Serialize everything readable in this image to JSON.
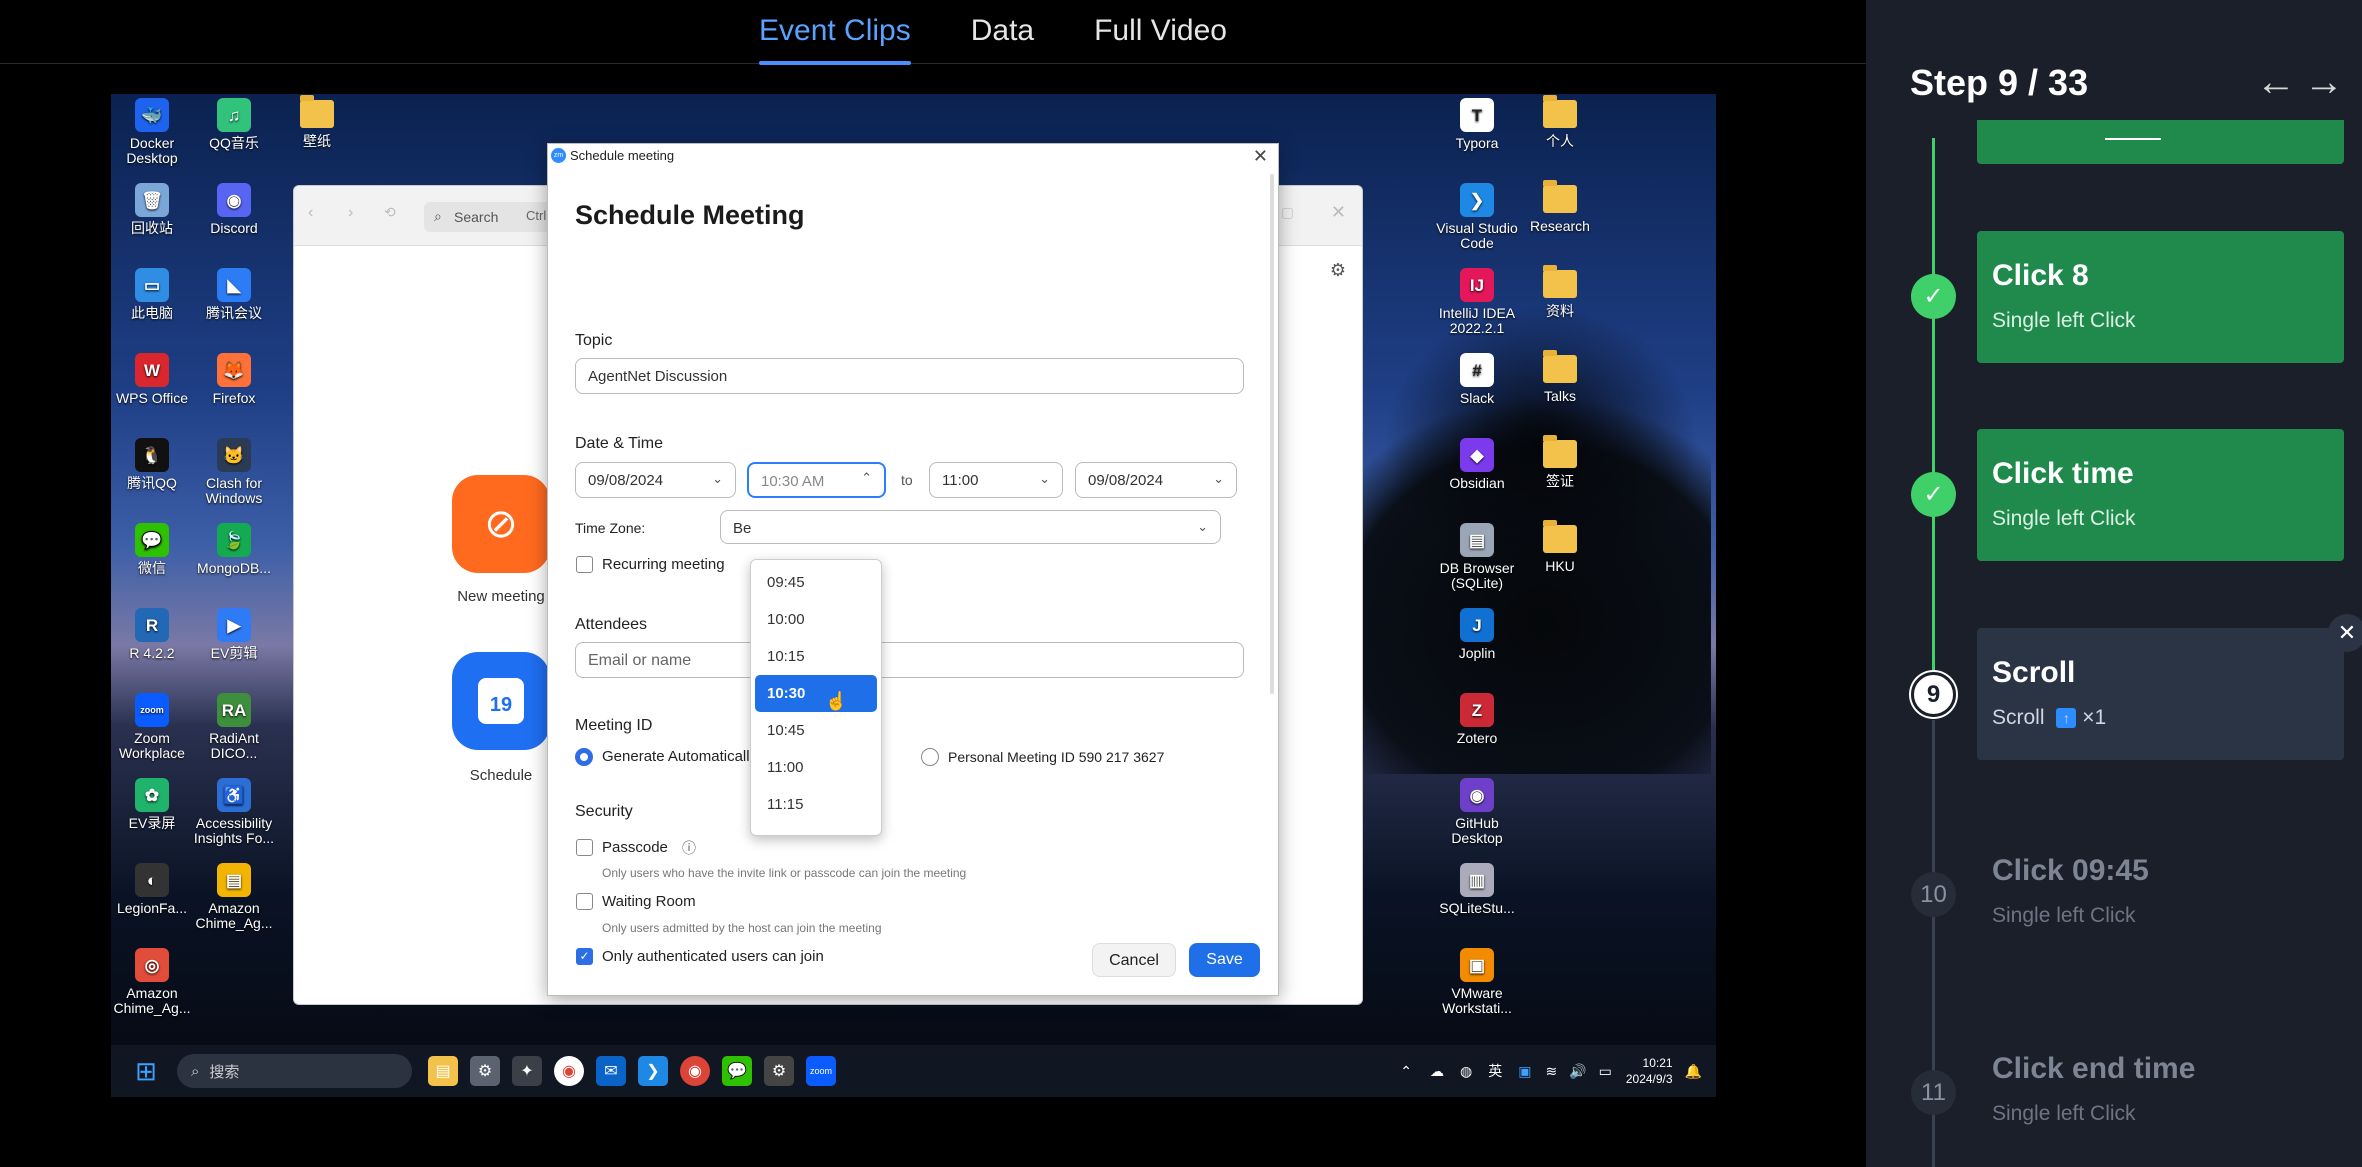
{
  "tabs": [
    "Event Clips",
    "Data",
    "Full Video"
  ],
  "desktop": {
    "left_icons": [
      {
        "label": "Docker Desktop",
        "color": "#1d63ed",
        "glyph": "🐳"
      },
      {
        "label": "QQ音乐",
        "color": "#31c27c",
        "glyph": "♫"
      },
      {
        "label": "壁纸",
        "color": "",
        "glyph": "folder"
      },
      {
        "label": "回收站",
        "color": "#7aa6d8",
        "glyph": "🗑"
      },
      {
        "label": "Discord",
        "color": "#5865f2",
        "glyph": "◉"
      },
      {
        "label": "此电脑",
        "color": "#2f8de4",
        "glyph": "▭"
      },
      {
        "label": "腾讯会议",
        "color": "#2c7cf6",
        "glyph": "◣"
      },
      {
        "label": "WPS Office",
        "color": "#d9272d",
        "glyph": "W"
      },
      {
        "label": "Firefox",
        "color": "#ff7139",
        "glyph": "🦊"
      },
      {
        "label": "腾讯QQ",
        "color": "#111",
        "glyph": "🐧"
      },
      {
        "label": "Clash for Windows",
        "color": "#2b3a55",
        "glyph": "🐱"
      },
      {
        "label": "微信",
        "color": "#2dc100",
        "glyph": "💬"
      },
      {
        "label": "MongoDB...",
        "color": "#13aa52",
        "glyph": "🍃"
      },
      {
        "label": "R 4.2.2",
        "color": "#2268b5",
        "glyph": "R"
      },
      {
        "label": "EV剪辑",
        "color": "#2f7af5",
        "glyph": "▶"
      },
      {
        "label": "Zoom Workplace",
        "color": "#0b5cff",
        "glyph": "zoom"
      },
      {
        "label": "RadiAnt DICO...",
        "color": "#3d8f3d",
        "glyph": "RA"
      },
      {
        "label": "EV录屏",
        "color": "#1fb36b",
        "glyph": "✿"
      },
      {
        "label": "Accessibility Insights Fo...",
        "color": "#2b6fd6",
        "glyph": "♿"
      },
      {
        "label": "LegionFa...",
        "color": "#333",
        "glyph": "◐"
      },
      {
        "label": "Amazon Chime_Ag...",
        "color": "#f2b400",
        "glyph": "▤"
      },
      {
        "label": "Amazon Chime_Ag...",
        "color": "#e24c3a",
        "glyph": "◎"
      }
    ],
    "right_icons": [
      {
        "label": "Typora",
        "color": "#fff",
        "glyph": "T"
      },
      {
        "label": "个人",
        "color": "",
        "glyph": "folder"
      },
      {
        "label": "Visual Studio Code",
        "color": "#1e88e5",
        "glyph": "❯"
      },
      {
        "label": "Research",
        "color": "",
        "glyph": "folder"
      },
      {
        "label": "IntelliJ IDEA 2022.2.1",
        "color": "#e3175a",
        "glyph": "IJ"
      },
      {
        "label": "资料",
        "color": "",
        "glyph": "folder"
      },
      {
        "label": "Slack",
        "color": "#fff",
        "glyph": "#"
      },
      {
        "label": "Talks",
        "color": "",
        "glyph": "folder"
      },
      {
        "label": "Obsidian",
        "color": "#7c3aed",
        "glyph": "◆"
      },
      {
        "label": "签证",
        "color": "",
        "glyph": "folder"
      },
      {
        "label": "DB Browser (SQLite)",
        "color": "#9aa5b5",
        "glyph": "▤"
      },
      {
        "label": "HKU",
        "color": "",
        "glyph": "folder"
      },
      {
        "label": "Joplin",
        "color": "#1071d3",
        "glyph": "J"
      },
      {
        "label": "Zotero",
        "color": "#cc2936",
        "glyph": "Z"
      },
      {
        "label": "GitHub Desktop",
        "color": "#6e40c9",
        "glyph": "◉"
      },
      {
        "label": "SQLiteStu...",
        "color": "#aab",
        "glyph": "▥"
      },
      {
        "label": "VMware Workstati...",
        "color": "#f38b00",
        "glyph": "▣"
      }
    ]
  },
  "zoom_window": {
    "search": "Search",
    "shortcut": "Ctrl",
    "apps": [
      {
        "label": "New meeting"
      },
      {
        "label": "Schedule",
        "day": "19"
      }
    ]
  },
  "dialog": {
    "window_title": "Schedule meeting",
    "heading": "Schedule Meeting",
    "topic_label": "Topic",
    "topic_value": "AgentNet Discussion",
    "datetime_label": "Date & Time",
    "start_date": "09/08/2024",
    "start_time": "10:30 AM",
    "to_label": "to",
    "end_time": "11:00",
    "end_date": "09/08/2024",
    "timezone_label": "Time Zone:",
    "timezone_value": "Be",
    "recurring_label": "Recurring meeting",
    "attendees_label": "Attendees",
    "attendees_placeholder": "Email or name",
    "meeting_id_label": "Meeting ID",
    "generate_label": "Generate Automaticall",
    "personal_label": "Personal Meeting ID 590 217 3627",
    "security_label": "Security",
    "passcode_label": "Passcode",
    "passcode_hint": "Only users who have the invite link or passcode can join the meeting",
    "waiting_label": "Waiting Room",
    "waiting_hint": "Only users admitted by the host can join the meeting",
    "auth_label": "Only authenticated users can join",
    "cancel": "Cancel",
    "save": "Save",
    "time_options": [
      "09:45",
      "10:00",
      "10:15",
      "10:30",
      "10:45",
      "11:00",
      "11:15"
    ],
    "selected_time": "10:30"
  },
  "taskbar": {
    "search": "搜索",
    "ime": "英",
    "time": "10:21",
    "date": "2024/9/3"
  },
  "panel": {
    "step": "Step 9 / 33",
    "steps": [
      {
        "num": "",
        "title": "Click 8",
        "subtitle": "Single left Click",
        "state": "done"
      },
      {
        "num": "",
        "title": "Click time",
        "subtitle": "Single left Click",
        "state": "done"
      },
      {
        "num": "9",
        "title": "Scroll",
        "subtitle": "Scroll",
        "subtitle_extra": "×1",
        "state": "current"
      },
      {
        "num": "10",
        "title": "Click 09:45",
        "subtitle": "Single left Click",
        "state": "future"
      },
      {
        "num": "11",
        "title": "Click end time",
        "subtitle": "Single left Click",
        "state": "future"
      }
    ],
    "colors": {
      "done": "#1f8a4c",
      "current": "#2b3445",
      "line_done": "#3fd06a"
    }
  }
}
